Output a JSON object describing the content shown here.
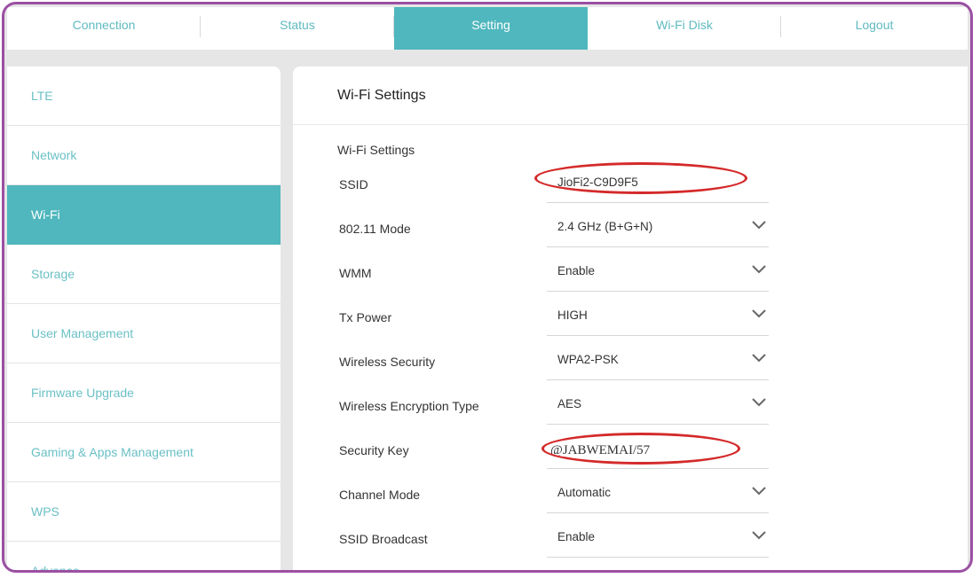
{
  "top_nav": {
    "tabs": [
      {
        "label": "Connection"
      },
      {
        "label": "Status"
      },
      {
        "label": "Setting"
      },
      {
        "label": "Wi-Fi Disk"
      },
      {
        "label": "Logout"
      }
    ],
    "active": "Setting"
  },
  "sidebar": {
    "items": [
      {
        "label": "LTE"
      },
      {
        "label": "Network"
      },
      {
        "label": "Wi-Fi"
      },
      {
        "label": "Storage"
      },
      {
        "label": "User Management"
      },
      {
        "label": "Firmware Upgrade"
      },
      {
        "label": "Gaming & Apps Management"
      },
      {
        "label": "WPS"
      },
      {
        "label": "Advance"
      }
    ],
    "active": "Wi-Fi"
  },
  "main": {
    "title": "Wi-Fi Settings",
    "section_title": "Wi-Fi Settings",
    "fields": [
      {
        "label": "SSID",
        "value": "JioFi2-C9D9F5",
        "type": "text"
      },
      {
        "label": "802.11 Mode",
        "value": "2.4 GHz (B+G+N)",
        "type": "select"
      },
      {
        "label": "WMM",
        "value": "Enable",
        "type": "select"
      },
      {
        "label": "Tx Power",
        "value": "HIGH",
        "type": "select"
      },
      {
        "label": "Wireless Security",
        "value": "WPA2-PSK",
        "type": "select"
      },
      {
        "label": "Wireless Encryption Type",
        "value": "AES",
        "type": "select"
      },
      {
        "label": "Security Key",
        "value": "@JABWEMAI/57",
        "type": "text"
      },
      {
        "label": "Channel Mode",
        "value": "Automatic",
        "type": "select"
      },
      {
        "label": "SSID Broadcast",
        "value": "Enable",
        "type": "select"
      }
    ]
  },
  "colors": {
    "accent": "#4fb7bd",
    "frame": "#9b4fa3",
    "annotation": "#d42a2a"
  },
  "icons": {
    "select_arrow": "chevron-down-icon"
  }
}
